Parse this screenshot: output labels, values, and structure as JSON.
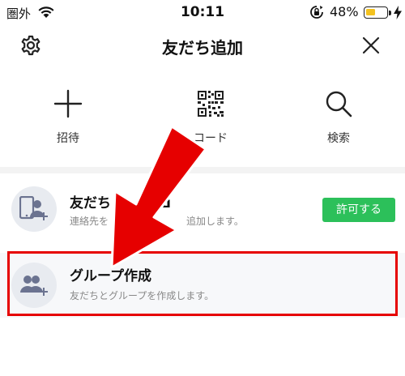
{
  "status_bar": {
    "carrier": "圏外",
    "time": "10:11",
    "battery_percent": "48%",
    "battery_level": 0.48,
    "icons": [
      "wifi-icon",
      "orientation-lock-icon",
      "battery-icon",
      "charging-bolt-icon"
    ]
  },
  "header": {
    "title": "友だち追加",
    "icons": [
      "gear-icon",
      "close-icon"
    ]
  },
  "actions": [
    {
      "label": "招待",
      "icon": "plus-icon"
    },
    {
      "label": "コード",
      "icon": "qr-code-icon"
    },
    {
      "label": "検索",
      "icon": "search-icon"
    }
  ],
  "list": {
    "row1": {
      "title": "友だち",
      "title_tail": "ш",
      "subtitle_start": "連絡先を",
      "subtitle_end": "追加します。",
      "button": "許可する",
      "icon": "phone-contact-icon"
    },
    "row2": {
      "title": "グループ作成",
      "subtitle": "友だちとグループを作成します。",
      "icon": "group-add-icon"
    }
  },
  "annotation": {
    "arrow_color": "#e60000",
    "highlight_color": "#e60000"
  },
  "colors": {
    "allow_button": "#2cc05a",
    "battery_fill": "#f4c21f"
  }
}
